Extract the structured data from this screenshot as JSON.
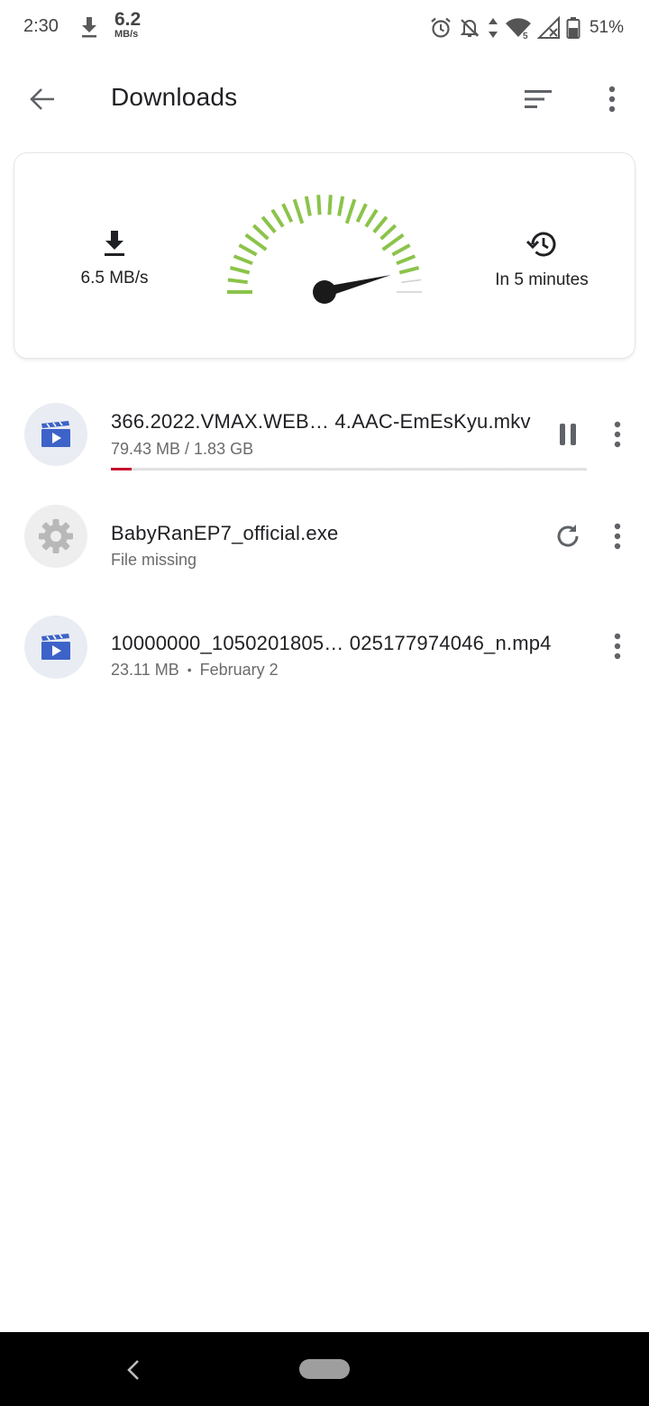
{
  "status_bar": {
    "time": "2:30",
    "speed_value": "6.2",
    "speed_unit": "MB/s",
    "battery_percent": "51%",
    "icons": [
      "download-icon",
      "alarm-icon",
      "notifications-off-icon",
      "data-arrows-icon",
      "wifi-icon",
      "signal-icon",
      "battery-icon"
    ]
  },
  "app_bar": {
    "title": "Downloads",
    "icons": [
      "arrow-back-icon",
      "sort-icon",
      "more-vert-icon"
    ]
  },
  "speed_card": {
    "current_speed": "6.5 MB/s",
    "eta": "In 5 minutes",
    "gauge_level": 0.92,
    "colors": {
      "gauge_active": "#8bc34a",
      "gauge_inactive": "#cfcfcf",
      "needle": "#1a1a1a"
    }
  },
  "downloads": [
    {
      "name": "366.2022.VMAX.WEB…  4.AAC-EmEsKyu.mkv",
      "subtitle": "79.43 MB / 1.83 GB",
      "progress": 0.043,
      "type_icon": "video-file-icon",
      "action_icon": "pause-icon"
    },
    {
      "name": "BabyRanEP7_official.exe",
      "subtitle": "File missing",
      "type_icon": "settings-gear-icon",
      "action_icon": "retry-icon"
    },
    {
      "name": "10000000_1050201805…  025177974046_n.mp4",
      "size": "23.11 MB",
      "date": "February 2",
      "type_icon": "video-file-icon"
    }
  ],
  "colors": {
    "accent": "#c8102e",
    "video_icon": "#3d63c9"
  }
}
